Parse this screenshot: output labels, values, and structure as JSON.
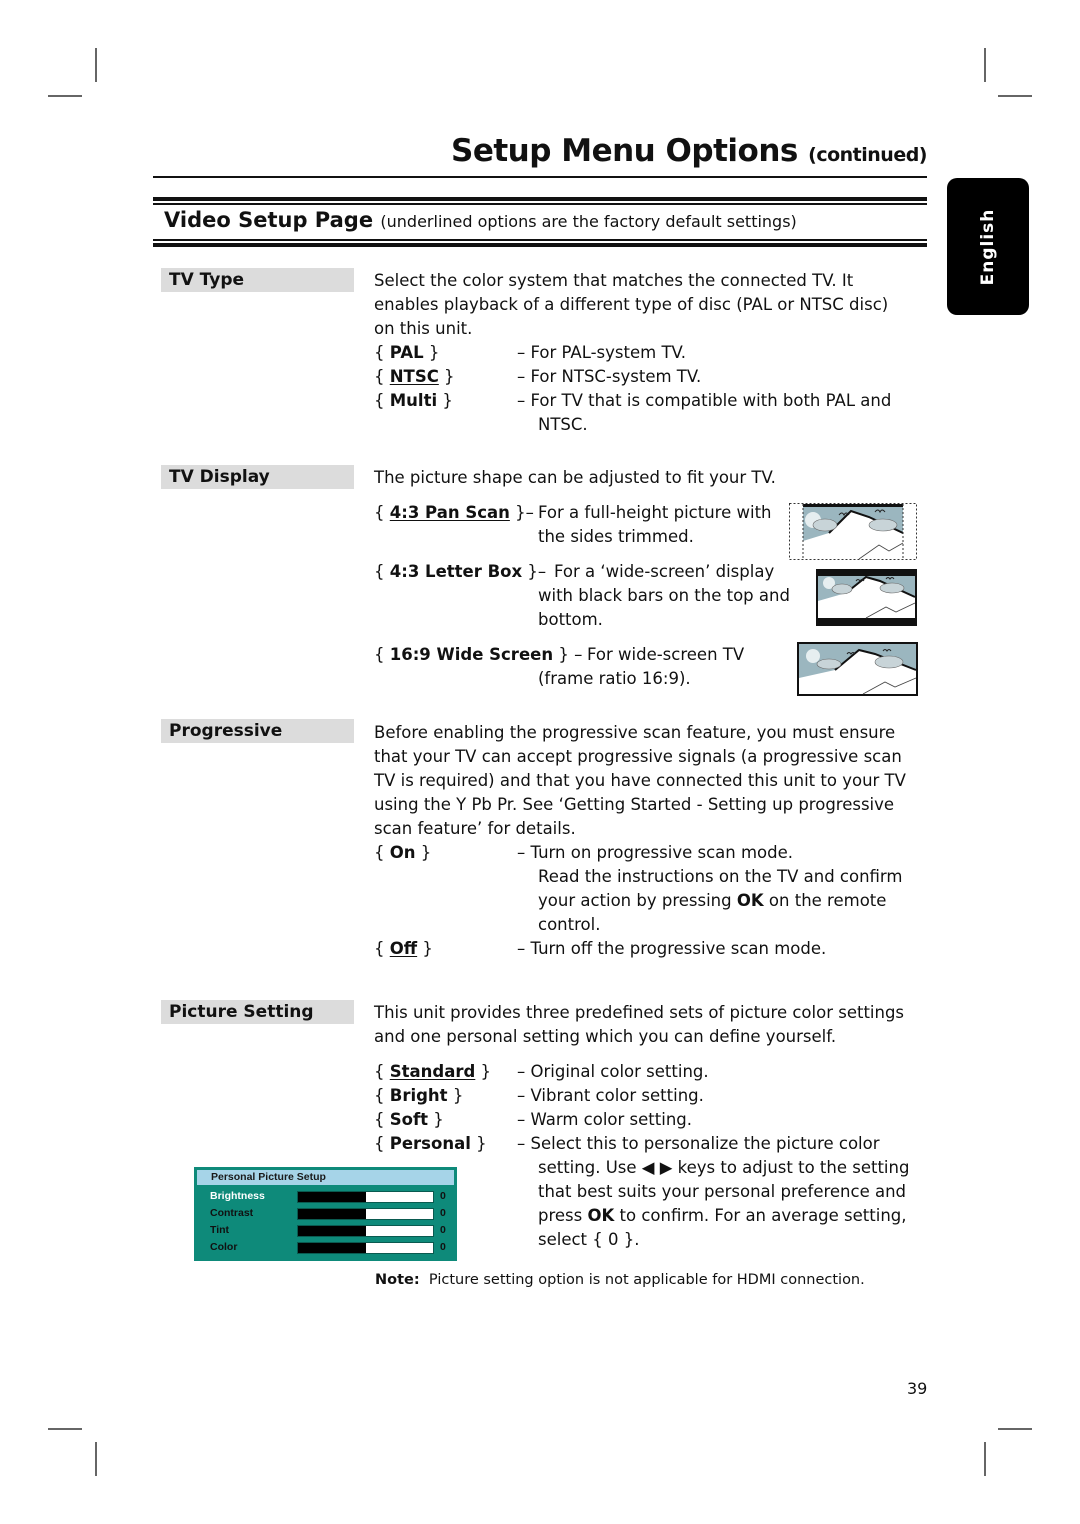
{
  "header": {
    "title": "Setup Menu Options",
    "title_suffix": "(continued)"
  },
  "section": {
    "title": "Video Setup Page",
    "subtitle": "(underlined options are the factory default settings)"
  },
  "language_tab": "English",
  "settings": {
    "tv_type": {
      "label": "TV Type",
      "description": [
        "Select the color system that matches the connected TV.  It",
        "enables playback of a different type of disc (PAL or NTSC disc)",
        "on this unit."
      ],
      "options": [
        {
          "name": "PAL",
          "default": false,
          "desc": [
            "– For PAL-system TV."
          ]
        },
        {
          "name": "NTSC",
          "default": true,
          "desc": [
            "– For NTSC-system TV."
          ]
        },
        {
          "name": "Multi",
          "default": false,
          "desc": [
            "– For TV that is compatible with both PAL and",
            "NTSC."
          ]
        }
      ]
    },
    "tv_display": {
      "label": "TV Display",
      "description": "The picture shape can be adjusted to fit your TV.",
      "options": [
        {
          "name": "4:3 Pan Scan",
          "default": true,
          "sep": "}–",
          "desc": [
            "For a full-height picture with",
            "the sides trimmed."
          ],
          "icon": "pan-scan-illustration"
        },
        {
          "name": "4:3 Letter Box",
          "default": false,
          "sep": "}–",
          "desc": [
            "For a ‘wide-screen’ display",
            "with black bars on the top and",
            "bottom."
          ],
          "icon": "letter-box-illustration"
        },
        {
          "name": "16:9 Wide Screen",
          "default": false,
          "sep": "} –",
          "desc": [
            "For wide-screen TV",
            "(frame ratio 16:9)."
          ],
          "icon": "wide-screen-illustration"
        }
      ]
    },
    "progressive": {
      "label": "Progressive",
      "description": [
        "Before enabling the progressive scan feature, you must ensure",
        "that your TV can accept progressive signals (a progressive scan",
        "TV is required) and that you have connected this unit to your TV",
        "using the Y Pb Pr.  See ‘Getting Started - Setting up progressive",
        "scan feature’ for details."
      ],
      "options": [
        {
          "name": "On",
          "default": false,
          "desc_first": "– Turn on progressive scan mode.",
          "desc_more": [
            "Read the instructions on the TV and confirm",
            "your action by pressing ",
            "OK",
            " on the remote",
            "control."
          ]
        },
        {
          "name": "Off",
          "default": true,
          "desc_first": "– Turn off the progressive scan mode."
        }
      ]
    },
    "picture_setting": {
      "label": "Picture Setting",
      "description": [
        "This unit provides three predefined sets of picture color settings",
        "and one personal setting which you can define yourself."
      ],
      "options": [
        {
          "name": "Standard",
          "default": true,
          "desc": "– Original color setting."
        },
        {
          "name": "Bright",
          "default": false,
          "desc": "– Vibrant color setting."
        },
        {
          "name": "Soft",
          "default": false,
          "desc": "– Warm color setting."
        },
        {
          "name": "Personal",
          "default": false,
          "desc": "– Select this to personalize the picture color"
        }
      ],
      "personal_more": {
        "line1_a": "setting. Use ",
        "arrows": "◀ ▶",
        "line1_b": " keys to adjust to the setting",
        "line2": "that best suits your personal preference and",
        "line3_a": "press ",
        "ok": "OK",
        "line3_b": " to confirm.  For an average setting,",
        "line4": "select { 0 }."
      },
      "personal_setup_panel": {
        "title": "Personal Picture Setup",
        "rows": [
          {
            "label": "Brightness",
            "value": "0",
            "level": 0.5,
            "selected": true
          },
          {
            "label": "Contrast",
            "value": "0",
            "level": 0.5,
            "selected": false
          },
          {
            "label": "Tint",
            "value": "0",
            "level": 0.5,
            "selected": false
          },
          {
            "label": "Color",
            "value": "0",
            "level": 0.5,
            "selected": false
          }
        ],
        "colors": {
          "panel": "#0e8a7a",
          "title_bar": "#a6d4e8"
        }
      }
    }
  },
  "note": {
    "label": "Note:",
    "text": "Picture setting option is not applicable for HDMI connection."
  },
  "page_number": "39"
}
